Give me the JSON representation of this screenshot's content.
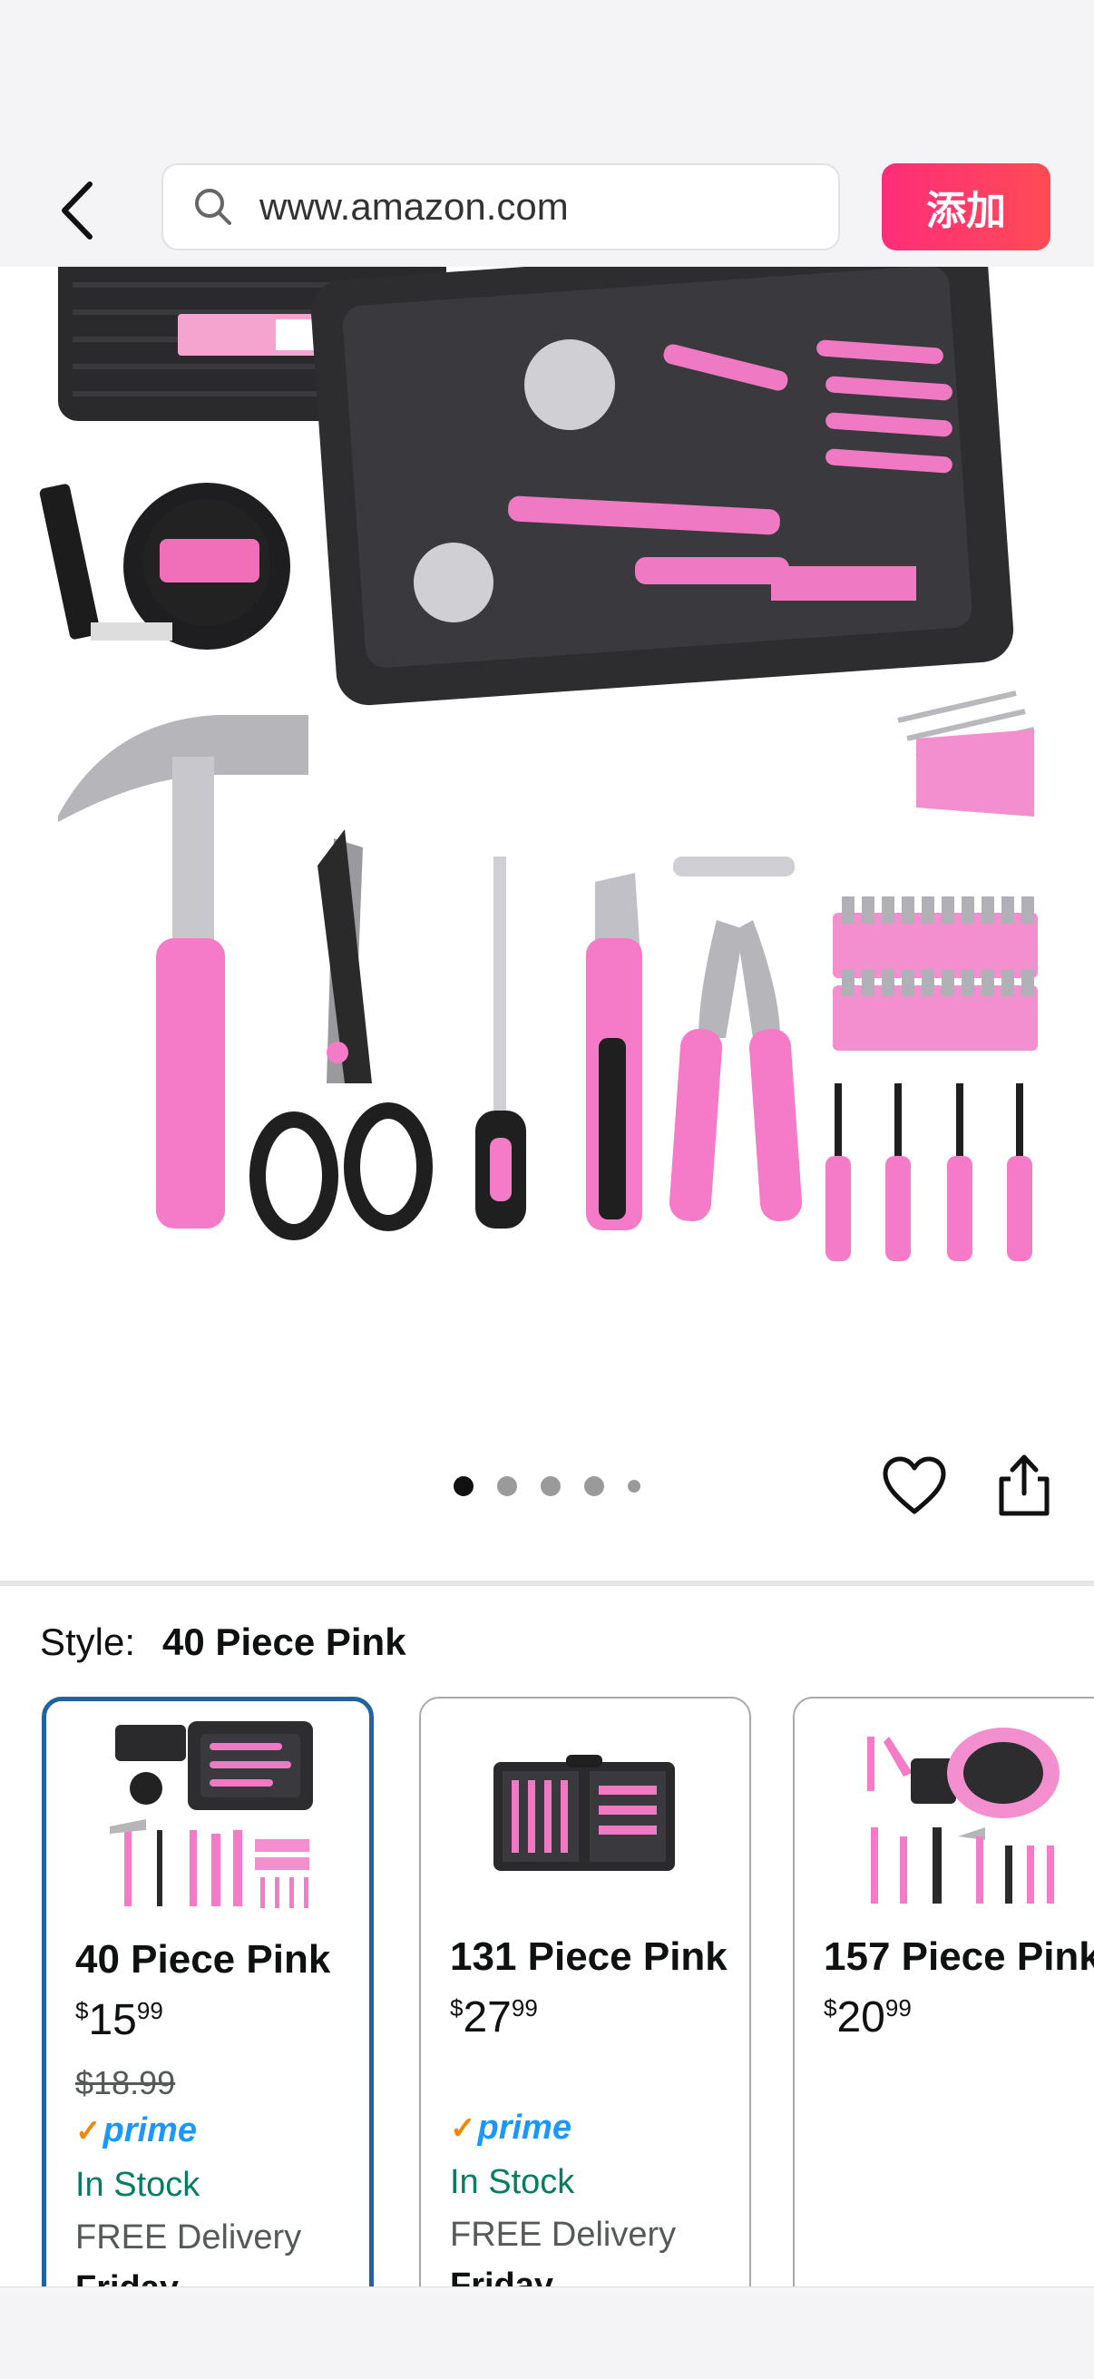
{
  "browser": {
    "url": "www.amazon.com",
    "add_label": "添加"
  },
  "gallery": {
    "image_count": 5,
    "active_index": 0
  },
  "style": {
    "label": "Style:",
    "selected": "40 Piece Pink"
  },
  "options": [
    {
      "name": "40 Piece Pink",
      "currency": "$",
      "price_whole": "15",
      "price_cents": "99",
      "list_price": "$18.99",
      "prime": "prime",
      "stock": "In Stock",
      "delivery": "FREE Delivery",
      "day": "Friday"
    },
    {
      "name": "131 Piece Pink",
      "currency": "$",
      "price_whole": "27",
      "price_cents": "99",
      "prime": "prime",
      "stock": "In Stock",
      "delivery": "FREE Delivery",
      "day": "Friday"
    },
    {
      "name": "157 Piece Pink",
      "currency": "$",
      "price_whole": "20",
      "price_cents": "99"
    }
  ],
  "colors": {
    "accent_pink": "#ff2d7a",
    "selected_border": "#2162a1",
    "in_stock": "#067d62",
    "prime_blue": "#1a98ff"
  },
  "icons": [
    "back-icon",
    "search-icon",
    "heart-icon",
    "share-icon"
  ]
}
